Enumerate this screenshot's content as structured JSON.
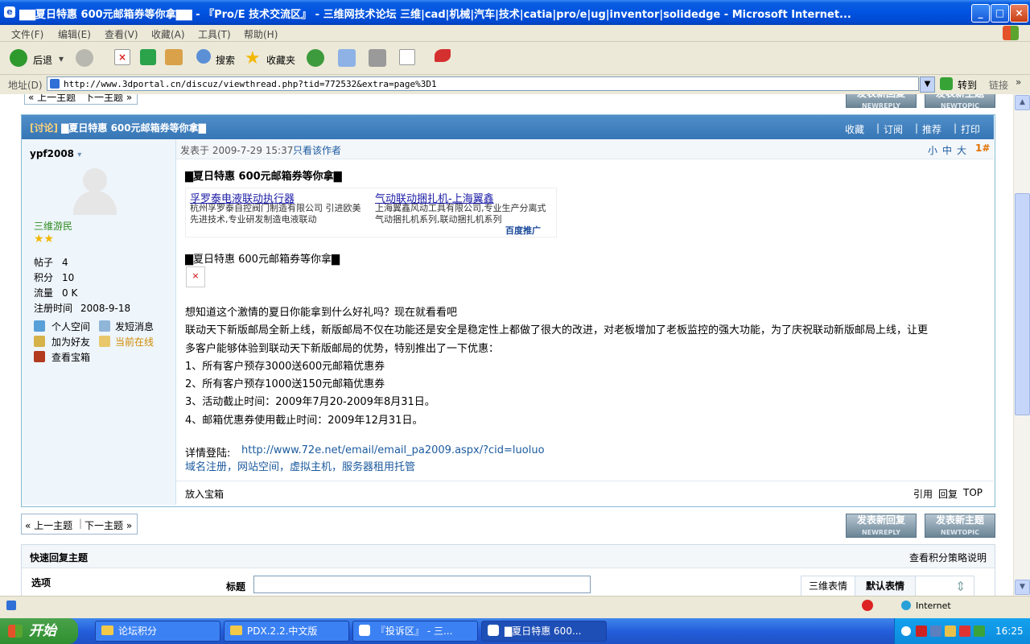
{
  "window": {
    "title": "▇▇夏日特惠 600元邮箱券等你拿▇▇ - 『Pro/E 技术交流区』 - 三维网技术论坛 三维|cad|机械|汽车|技术|catia|pro/e|ug|inventor|solidedge - Microsoft Internet..."
  },
  "menu": [
    "文件(F)",
    "编辑(E)",
    "查看(V)",
    "收藏(A)",
    "工具(T)",
    "帮助(H)"
  ],
  "toolbar": {
    "back": "后退",
    "search": "搜索",
    "favorites": "收藏夹"
  },
  "address": {
    "label": "地址(D)",
    "url": "http://www.3dportal.cn/discuz/viewthread.php?tid=772532&extra=page%3D1",
    "go": "转到",
    "links": "链接"
  },
  "nav": {
    "prev": "上一主题",
    "next": "下一主题",
    "sep": "|"
  },
  "buttons": {
    "reply": "发表新回复",
    "reply_sub": "NEWREPLY",
    "newtopic": "发表新主题",
    "newtopic_sub": "NEWTOPIC"
  },
  "post": {
    "tag": "[讨论]",
    "title": "▇夏日特惠 600元邮箱券等你拿▇",
    "actions": [
      "收藏",
      "订阅",
      "推荐",
      "打印"
    ],
    "posted_label": "发表于",
    "posted_time": "2009-7-29 15:37",
    "author_only": "只看该作者",
    "font_sizes": [
      "小",
      "中",
      "大"
    ],
    "floor": "1#",
    "heading": "▇夏日特惠 600元邮箱券等你拿▇",
    "subheading": "▇夏日特惠 600元邮箱券等你拿▇",
    "ads": [
      {
        "title": "孚罗泰电液联动执行器",
        "desc": "杭州孚罗泰自控阀门制造有限公司 引进欧美先进技术,专业研发制造电液联动"
      },
      {
        "title": "气动联动捆扎机-上海翼鑫",
        "desc": "上海翼鑫风动工具有限公司,专业生产分离式气动捆扎机系列,联动捆扎机系列"
      }
    ],
    "ad_brand": "百度推广",
    "body": [
      "想知道这个激情的夏日你能拿到什么好礼吗？现在就看看吧",
      "联动天下新版邮局全新上线，新版邮局不仅在功能还是安全是稳定性上都做了很大的改进，对老板增加了老板监控的强大功能，为了庆祝联动新版邮局上线，让更",
      "多客户能够体验到联动天下新版邮局的优势，特别推出了一下优惠：",
      "1、所有客户预存3000送600元邮箱优惠券",
      "2、所有客户预存1000送150元邮箱优惠券",
      "3、活动截止时间：2009年7月20-2009年8月31日。",
      "4、邮箱优惠券使用截止时间：2009年12月31日。"
    ],
    "detail_label": "详情登陆:",
    "detail_link": "http://www.72e.net/email/email_pa2009.aspx/?cid=luoluo",
    "footer_links": "域名注册，网站空间，虚拟主机，服务器租用托管",
    "treasure": "放入宝箱",
    "bottom_actions": [
      "引用",
      "回复",
      "TOP"
    ]
  },
  "author": {
    "name": "ypf2008",
    "rank": "三维游民",
    "stats": [
      {
        "k": "帖子",
        "v": "4"
      },
      {
        "k": "积分",
        "v": "10"
      },
      {
        "k": "流量",
        "v": "0 K"
      },
      {
        "k": "注册时间",
        "v": "2008-9-18"
      }
    ],
    "links": {
      "space": "个人空间",
      "pm": "发短消息",
      "friend": "加为好友",
      "online": "当前在线",
      "treasure": "查看宝箱"
    }
  },
  "quickreply": {
    "title": "快速回复主题",
    "help": "查看积分策略说明",
    "options": "选项",
    "subject": "标题",
    "tabs": [
      "三维表情",
      "默认表情"
    ]
  },
  "status": {
    "zone": "Internet"
  },
  "taskbar": {
    "start": "开始",
    "tasks": [
      "论坛积分",
      "PDX.2.2.中文版",
      "『投诉区』 - 三...",
      "▇夏日特惠 600..."
    ],
    "clock": "16:25"
  },
  "colors": {
    "accent": "#3776b6",
    "link": "#1b5a9e",
    "rank": "#2e8b1f"
  }
}
